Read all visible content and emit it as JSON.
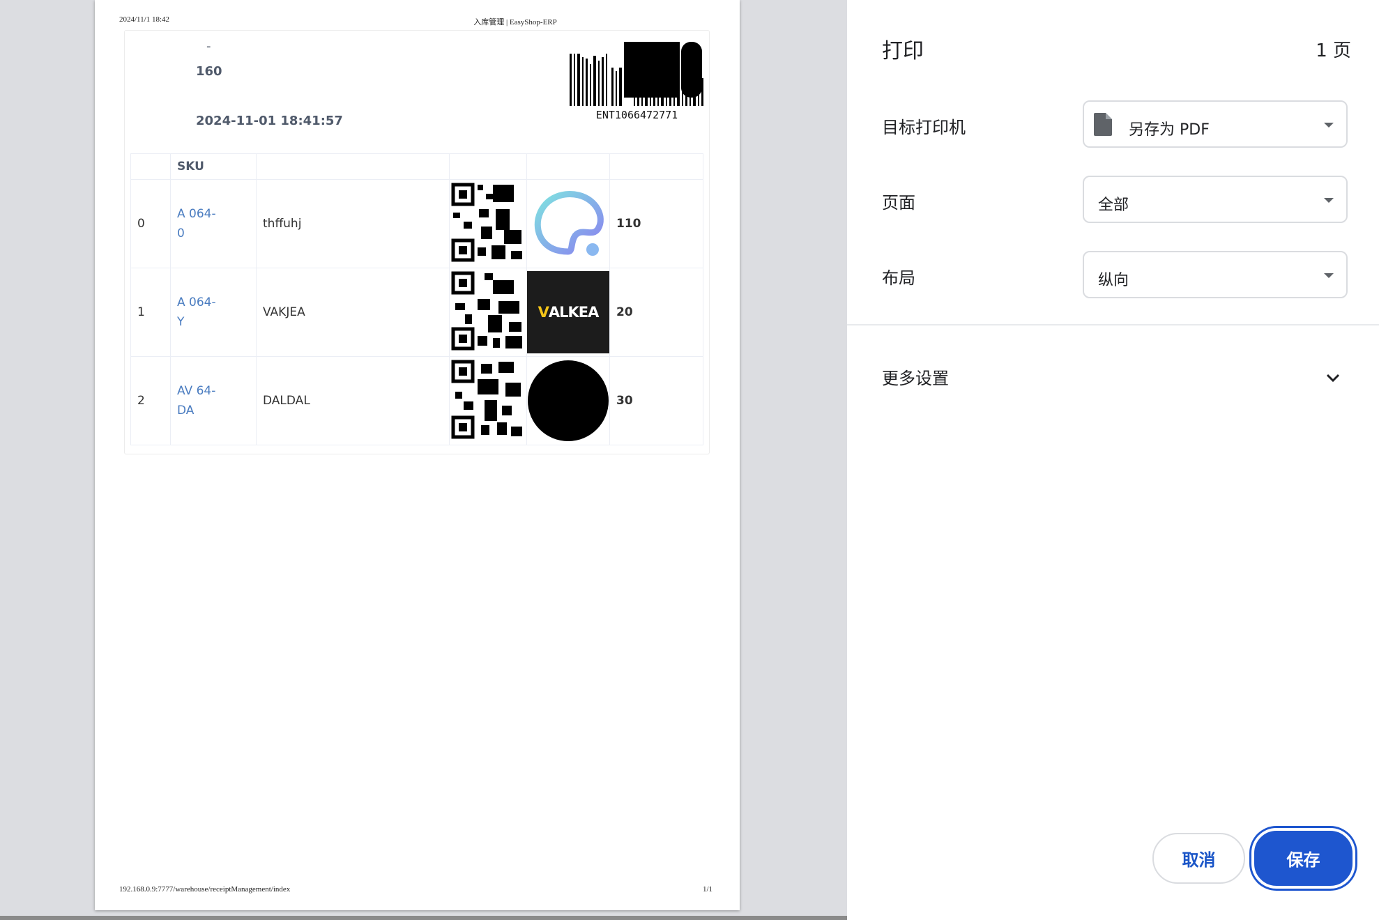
{
  "preview": {
    "header_datetime": "2024/11/1 18:42",
    "header_title": "入库管理 | EasyShop-ERP",
    "footer_url": "192.168.0.9:7777/warehouse/receiptManagement/index",
    "footer_page": "1/1",
    "info_dash": "-",
    "info_qty": "160",
    "info_datetime": "2024-11-01 18:41:57",
    "barcode_text": "ENT1066472771",
    "table": {
      "headers": [
        "",
        "SKU",
        "",
        "",
        "",
        ""
      ],
      "rows": [
        {
          "index": "0",
          "sku_line1": "A      064-",
          "sku_line2": "0",
          "name": "thffuhj",
          "image": "logo-swirl",
          "qty": "110"
        },
        {
          "index": "1",
          "sku_line1": "A      064-",
          "sku_line2": "Y",
          "name": "VAKJEA",
          "image": "valkea-logo",
          "qty": "20"
        },
        {
          "index": "2",
          "sku_line1": "AV     64-",
          "sku_line2": "DA",
          "name": "DALDAL",
          "image": "black-circle",
          "qty": "30"
        }
      ]
    },
    "valkea_text_1": "V",
    "valkea_text_2": "ALKEA"
  },
  "panel": {
    "title": "打印",
    "page_count": "1 页",
    "destination_label": "目标打印机",
    "destination_value": "另存为 PDF",
    "pages_label": "页面",
    "pages_value": "全部",
    "layout_label": "布局",
    "layout_value": "纵向",
    "more_settings_label": "更多设置",
    "cancel_label": "取消",
    "save_label": "保存"
  },
  "colors": {
    "accent": "#1e56cf",
    "link": "#4a7cc0",
    "preview_bg": "#dcdde1"
  }
}
